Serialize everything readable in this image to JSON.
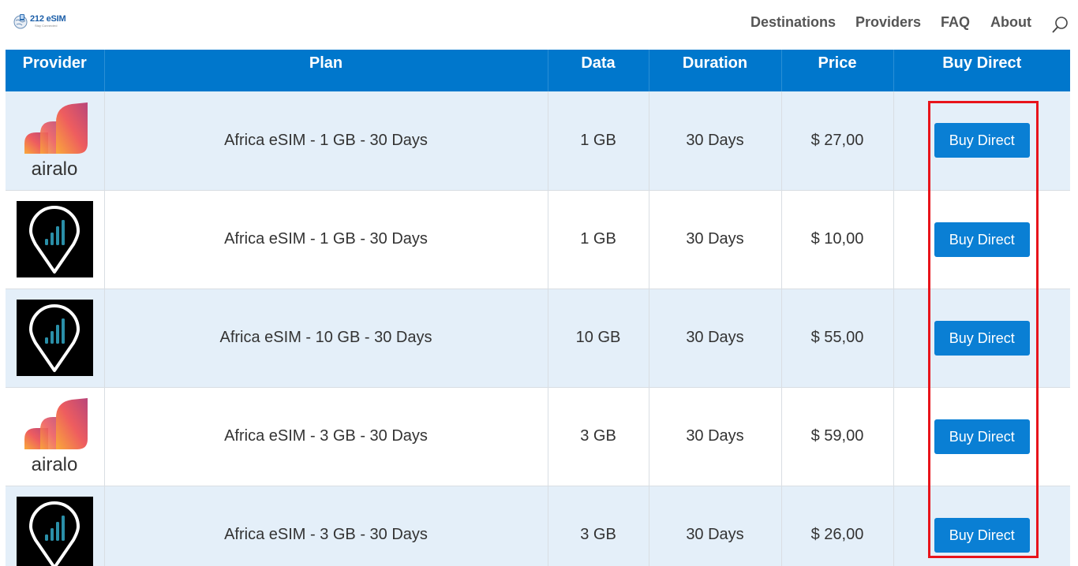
{
  "site": {
    "logo_text": "212 eSIM",
    "logo_tagline": "Stay Connected"
  },
  "nav": {
    "items": [
      {
        "label": "Destinations"
      },
      {
        "label": "Providers"
      },
      {
        "label": "FAQ"
      },
      {
        "label": "About"
      }
    ]
  },
  "table": {
    "headers": [
      "Provider",
      "Plan",
      "Data",
      "Duration",
      "Price",
      "Buy Direct"
    ],
    "rows": [
      {
        "provider": "airalo",
        "provider_logo_text": "airalo",
        "plan": "Africa eSIM - 1 GB - 30 Days",
        "data": "1 GB",
        "duration": "30 Days",
        "price": "$ 27,00",
        "button": "Buy Direct"
      },
      {
        "provider": "signal-pin",
        "plan": "Africa eSIM - 1 GB - 30 Days",
        "data": "1 GB",
        "duration": "30 Days",
        "price": "$ 10,00",
        "button": "Buy Direct"
      },
      {
        "provider": "signal-pin",
        "plan": "Africa eSIM - 10 GB - 30 Days",
        "data": "10 GB",
        "duration": "30 Days",
        "price": "$ 55,00",
        "button": "Buy Direct"
      },
      {
        "provider": "airalo",
        "provider_logo_text": "airalo",
        "plan": "Africa eSIM - 3 GB - 30 Days",
        "data": "3 GB",
        "duration": "30 Days",
        "price": "$ 59,00",
        "button": "Buy Direct"
      },
      {
        "provider": "signal-pin",
        "plan": "Africa eSIM - 3 GB - 30 Days",
        "data": "3 GB",
        "duration": "30 Days",
        "price": "$ 26,00",
        "button": "Buy Direct"
      }
    ]
  },
  "colors": {
    "header_bg": "#0077cc",
    "button_bg": "#0a7fd4",
    "row_shaded": "#e4eff9",
    "highlight": "#e8141b"
  }
}
